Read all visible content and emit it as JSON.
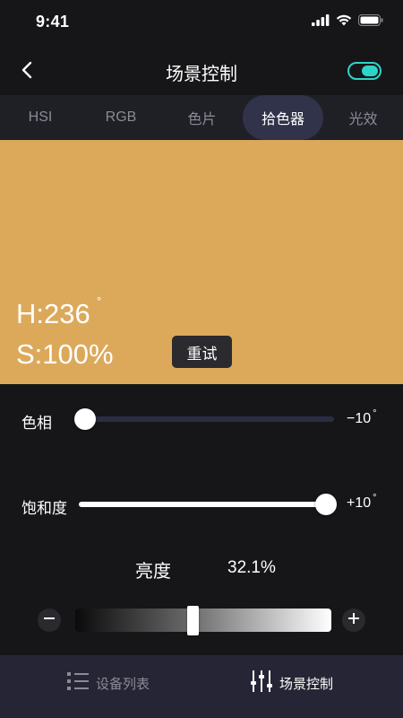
{
  "status_bar": {
    "time": "9:41",
    "icons": [
      "signal-icon",
      "wifi-icon",
      "battery-icon"
    ]
  },
  "nav": {
    "title": "场景控制",
    "back_icon": "chevron-left-icon",
    "power_on": true
  },
  "tabs": [
    {
      "label": "HSI",
      "active": false
    },
    {
      "label": "RGB",
      "active": false
    },
    {
      "label": "色片",
      "active": false
    },
    {
      "label": "拾色器",
      "active": true
    },
    {
      "label": "光效",
      "active": false
    }
  ],
  "picker": {
    "color": "#dca95b",
    "hue_readout": "H:236",
    "degree_symbol": "°",
    "saturation_readout": "S:100%",
    "retry_label": "重试"
  },
  "hue_slider": {
    "label": "色相",
    "value_text": "−10",
    "unit": "°",
    "level": 0
  },
  "saturation_slider": {
    "label": "饱和度",
    "value_text": "+10",
    "unit": "°",
    "level": 1
  },
  "brightness": {
    "label": "亮度",
    "value_text": "32.1%",
    "level": 0.321,
    "minus_icon": "minus-icon",
    "plus_icon": "plus-icon"
  },
  "bottom_nav": [
    {
      "label": "设备列表",
      "icon": "list-icon",
      "active": false
    },
    {
      "label": "场景控制",
      "icon": "sliders-icon",
      "active": true
    }
  ],
  "colors": {
    "accent": "#2fd4c8",
    "background": "#161618",
    "tab_bar": "#1f1f26",
    "active_tab_pill": "#31334a",
    "bottom_bar": "#252535"
  }
}
